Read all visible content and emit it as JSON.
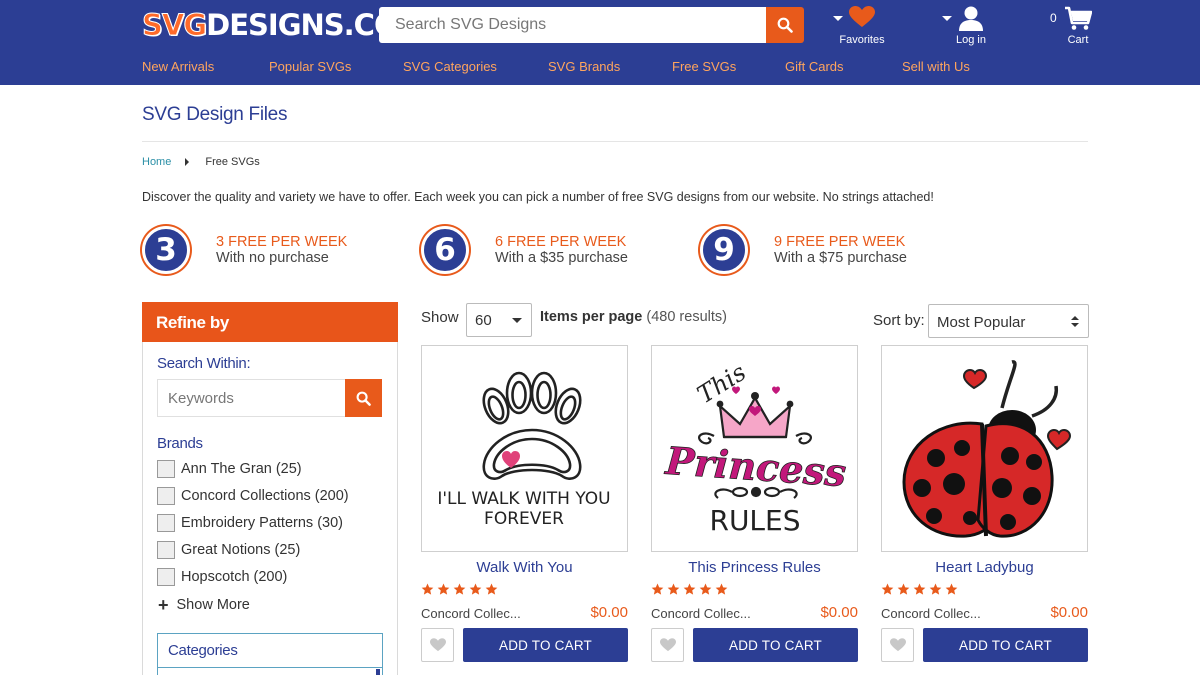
{
  "header": {
    "logo_svg": "SVG",
    "logo_rest": "DESIGNS.COM",
    "search_placeholder": "Search SVG Designs",
    "favorites_label": "Favorites",
    "login_label": "Log in",
    "cart_label": "Cart",
    "cart_count": "0",
    "colors": {
      "bar": "#2c3e94",
      "accent": "#e85a1b",
      "nav_link": "#ffa55e"
    }
  },
  "nav": [
    "New Arrivals",
    "Popular SVGs",
    "SVG Categories",
    "SVG Brands",
    "Free SVGs",
    "Gift Cards",
    "Sell with Us"
  ],
  "page": {
    "title": "SVG Design Files",
    "breadcrumb_home": "Home",
    "breadcrumb_current": "Free SVGs",
    "intro": "Discover the quality and variety we have to offer. Each week you can pick a number of free SVG designs from our website. No strings attached!"
  },
  "tiers": [
    {
      "number": "3",
      "headline": "3 FREE PER WEEK",
      "sub": "With no purchase"
    },
    {
      "number": "6",
      "headline": "6 FREE PER WEEK",
      "sub": "With a $35 purchase"
    },
    {
      "number": "9",
      "headline": "9 FREE PER WEEK",
      "sub": "With a $75 purchase"
    }
  ],
  "sidebar": {
    "refine_title": "Refine by",
    "search_within_label": "Search Within:",
    "keywords_placeholder": "Keywords",
    "brands_label": "Brands",
    "brands": [
      "Ann The Gran (25)",
      "Concord Collections (200)",
      "Embroidery Patterns (30)",
      "Great Notions (25)",
      "Hopscotch (200)"
    ],
    "show_more": "Show More",
    "categories_label": "Categories"
  },
  "toolbar": {
    "show_label": "Show",
    "per_page_value": "60",
    "items_per_page_label": "Items per page",
    "results": "(480 results)",
    "sort_label": "Sort by:",
    "sort_value": "Most Popular"
  },
  "products": [
    {
      "name": "Walk With You",
      "brand": "Concord Collec...",
      "price": "$0.00",
      "rating": 5,
      "cta": "ADD TO CART",
      "image_text": [
        "I'LL WALK WITH YOU",
        "FOREVER"
      ]
    },
    {
      "name": "This Princess Rules",
      "brand": "Concord Collec...",
      "price": "$0.00",
      "rating": 5,
      "cta": "ADD TO CART",
      "image_text": [
        "This",
        "Princess",
        "RULES"
      ]
    },
    {
      "name": "Heart Ladybug",
      "brand": "Concord Collec...",
      "price": "$0.00",
      "rating": 5,
      "cta": "ADD TO CART",
      "image_text": []
    }
  ]
}
